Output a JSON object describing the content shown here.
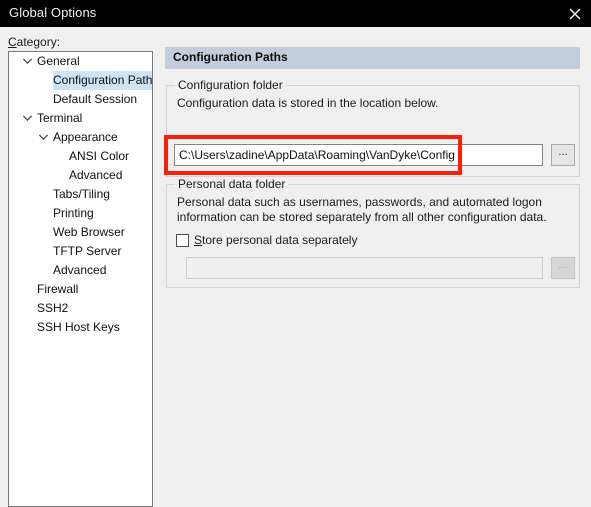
{
  "window": {
    "title": "Global Options",
    "close_icon": "close-icon"
  },
  "sidebar": {
    "label": "Category:",
    "label_accel": "C",
    "label_rest": "ategory:",
    "items": [
      {
        "label": "General",
        "level": 0,
        "expander": "chevron-down",
        "selected": false
      },
      {
        "label": "Configuration Paths",
        "level": 1,
        "expander": "none",
        "selected": true
      },
      {
        "label": "Default Session",
        "level": 1,
        "expander": "none",
        "selected": false
      },
      {
        "label": "Terminal",
        "level": 0,
        "expander": "chevron-down",
        "selected": false
      },
      {
        "label": "Appearance",
        "level": 1,
        "expander": "chevron-down",
        "selected": false
      },
      {
        "label": "ANSI Color",
        "level": 2,
        "expander": "none",
        "selected": false
      },
      {
        "label": "Advanced",
        "level": 2,
        "expander": "none",
        "selected": false
      },
      {
        "label": "Tabs/Tiling",
        "level": 1,
        "expander": "none",
        "selected": false
      },
      {
        "label": "Printing",
        "level": 1,
        "expander": "none",
        "selected": false
      },
      {
        "label": "Web Browser",
        "level": 1,
        "expander": "none",
        "selected": false
      },
      {
        "label": "TFTP Server",
        "level": 1,
        "expander": "none",
        "selected": false
      },
      {
        "label": "Advanced",
        "level": 1,
        "expander": "none",
        "selected": false
      },
      {
        "label": "Firewall",
        "level": 0,
        "expander": "none",
        "selected": false
      },
      {
        "label": "SSH2",
        "level": 0,
        "expander": "none",
        "selected": false
      },
      {
        "label": "SSH Host Keys",
        "level": 0,
        "expander": "none",
        "selected": false
      }
    ]
  },
  "main": {
    "header": "Configuration Paths",
    "config_group": {
      "legend": "Configuration folder",
      "description": "Configuration data is stored in the location below.",
      "path_value": "C:\\Users\\zadine\\AppData\\Roaming\\VanDyke\\Config",
      "browse_label": "..."
    },
    "personal_group": {
      "legend": "Personal data folder",
      "description": "Personal data such as usernames, passwords, and automated logon information can be stored separately from all other configuration data.",
      "checkbox_label": "Store personal data separately",
      "checkbox_accel": "S",
      "checkbox_label_rest": "tore personal data separately",
      "checkbox_checked": false,
      "path_value": "",
      "path_placeholder": "",
      "browse_label": "..."
    }
  },
  "annotation": {
    "type": "red-rectangle-highlight",
    "color": "#fc1d0a",
    "targets": "configuration folder path field"
  },
  "colors": {
    "titlebar_bg": "#000000",
    "titlebar_fg": "#f0f0f0",
    "dialog_bg": "#f0f0f0",
    "header_band": "#c3cedd",
    "tree_selection": "#cde4f7",
    "annotation_red": "#fc1d0a"
  }
}
